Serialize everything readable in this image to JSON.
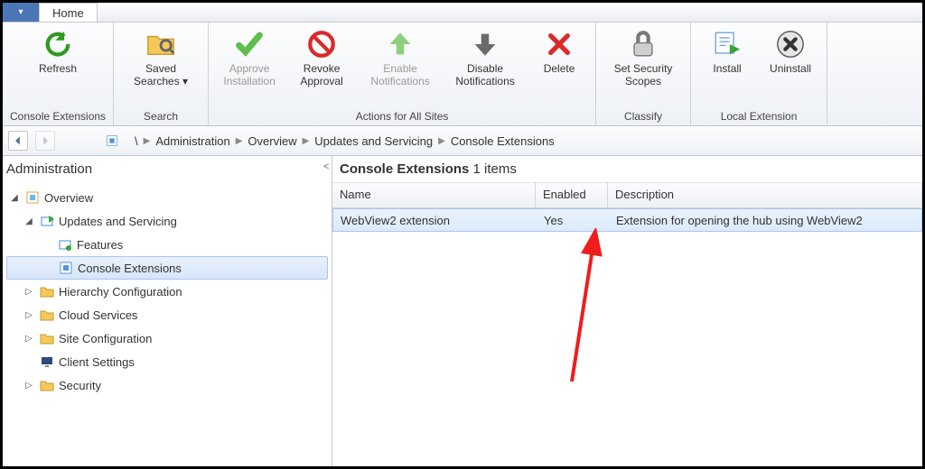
{
  "tabs": {
    "home": "Home"
  },
  "ribbon": {
    "groups": {
      "console_ext": "Console Extensions",
      "search": "Search",
      "actions": "Actions for All Sites",
      "classify": "Classify",
      "local_ext": "Local Extension"
    },
    "refresh": "Refresh",
    "saved_searches": "Saved\nSearches ▾",
    "approve": "Approve\nInstallation",
    "revoke": "Revoke\nApproval",
    "enable_notif": "Enable\nNotifications",
    "disable_notif": "Disable\nNotifications",
    "delete": "Delete",
    "set_security": "Set Security\nScopes",
    "install": "Install",
    "uninstall": "Uninstall"
  },
  "breadcrumbs": {
    "root": "\\",
    "items": [
      "Administration",
      "Overview",
      "Updates and Servicing",
      "Console Extensions"
    ]
  },
  "sidebar": {
    "title": "Administration",
    "nodes": {
      "overview": "Overview",
      "updates": "Updates and Servicing",
      "features": "Features",
      "console_ext": "Console Extensions",
      "hierarchy": "Hierarchy Configuration",
      "cloud": "Cloud Services",
      "site": "Site Configuration",
      "client": "Client Settings",
      "security": "Security"
    }
  },
  "content": {
    "title": "Console Extensions",
    "count": "1 items",
    "columns": {
      "name": "Name",
      "enabled": "Enabled",
      "desc": "Description"
    },
    "rows": [
      {
        "name": "WebView2 extension",
        "enabled": "Yes",
        "desc": "Extension for opening the hub using WebView2"
      }
    ]
  }
}
